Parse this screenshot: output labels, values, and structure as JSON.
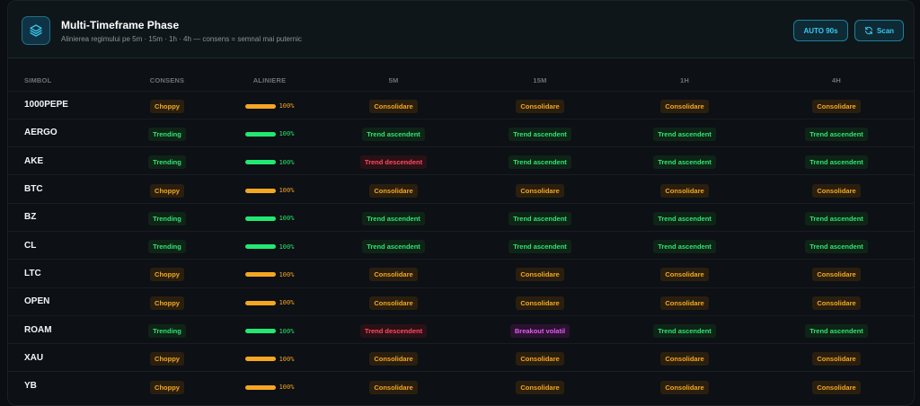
{
  "header": {
    "title": "Multi-Timeframe Phase",
    "subtitle": "Alinierea regimului pe 5m · 15m · 1h · 4h — consens = semnal mai puternic",
    "auto_label": "AUTO 90s",
    "scan_label": "Scan",
    "logo_icon": "layers-icon",
    "scan_icon": "refresh-icon"
  },
  "table": {
    "headers": [
      "SIMBOL",
      "CONSENS",
      "ALINIERE",
      "5M",
      "15M",
      "1H",
      "4H"
    ],
    "rows": [
      {
        "symbol": "1000PEPE",
        "consensus": "Choppy",
        "alignment": 100,
        "alignment_text": "100%",
        "tf": [
          "Consolidare",
          "Consolidare",
          "Consolidare",
          "Consolidare"
        ]
      },
      {
        "symbol": "AERGO",
        "consensus": "Trending",
        "alignment": 100,
        "alignment_text": "100%",
        "tf": [
          "Trend ascendent",
          "Trend ascendent",
          "Trend ascendent",
          "Trend ascendent"
        ]
      },
      {
        "symbol": "AKE",
        "consensus": "Trending",
        "alignment": 100,
        "alignment_text": "100%",
        "tf": [
          "Trend descendent",
          "Trend ascendent",
          "Trend ascendent",
          "Trend ascendent"
        ]
      },
      {
        "symbol": "BTC",
        "consensus": "Choppy",
        "alignment": 100,
        "alignment_text": "100%",
        "tf": [
          "Consolidare",
          "Consolidare",
          "Consolidare",
          "Consolidare"
        ]
      },
      {
        "symbol": "BZ",
        "consensus": "Trending",
        "alignment": 100,
        "alignment_text": "100%",
        "tf": [
          "Trend ascendent",
          "Trend ascendent",
          "Trend ascendent",
          "Trend ascendent"
        ]
      },
      {
        "symbol": "CL",
        "consensus": "Trending",
        "alignment": 100,
        "alignment_text": "100%",
        "tf": [
          "Trend ascendent",
          "Trend ascendent",
          "Trend ascendent",
          "Trend ascendent"
        ]
      },
      {
        "symbol": "LTC",
        "consensus": "Choppy",
        "alignment": 100,
        "alignment_text": "100%",
        "tf": [
          "Consolidare",
          "Consolidare",
          "Consolidare",
          "Consolidare"
        ]
      },
      {
        "symbol": "OPEN",
        "consensus": "Choppy",
        "alignment": 100,
        "alignment_text": "100%",
        "tf": [
          "Consolidare",
          "Consolidare",
          "Consolidare",
          "Consolidare"
        ]
      },
      {
        "symbol": "ROAM",
        "consensus": "Trending",
        "alignment": 100,
        "alignment_text": "100%",
        "tf": [
          "Trend descendent",
          "Breakout volatil",
          "Trend ascendent",
          "Trend ascendent"
        ]
      },
      {
        "symbol": "XAU",
        "consensus": "Choppy",
        "alignment": 100,
        "alignment_text": "100%",
        "tf": [
          "Consolidare",
          "Consolidare",
          "Consolidare",
          "Consolidare"
        ]
      },
      {
        "symbol": "YB",
        "consensus": "Choppy",
        "alignment": 100,
        "alignment_text": "100%",
        "tf": [
          "Consolidare",
          "Consolidare",
          "Consolidare",
          "Consolidare"
        ]
      }
    ]
  },
  "colors": {
    "choppy": "#f4a623",
    "trending": "#2ee56f",
    "descendent": "#ff4863",
    "volatil": "#e25cf0",
    "accent": "#39c7ee"
  }
}
